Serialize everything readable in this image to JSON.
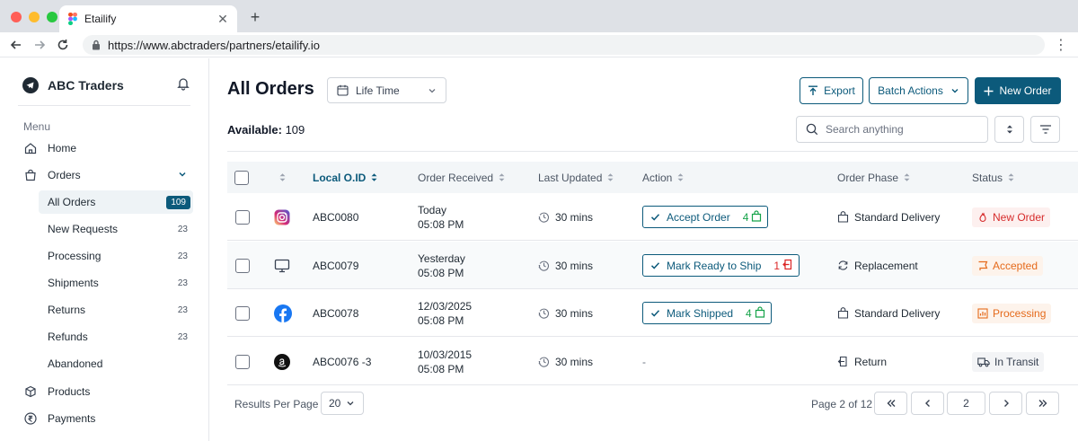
{
  "browser": {
    "tab_title": "Etailify",
    "url": "https://www.abctraders/partners/etailify.io"
  },
  "sidebar": {
    "brand": "ABC Traders",
    "menu_label": "Menu",
    "items": {
      "home": "Home",
      "orders": "Orders",
      "products": "Products",
      "payments": "Payments"
    },
    "sub_items": [
      {
        "label": "All Orders",
        "count": "109"
      },
      {
        "label": "New Requests",
        "count": "23"
      },
      {
        "label": "Processing",
        "count": "23"
      },
      {
        "label": "Shipments",
        "count": "23"
      },
      {
        "label": "Returns",
        "count": "23"
      },
      {
        "label": "Refunds",
        "count": "23"
      },
      {
        "label": "Abandoned",
        "count": ""
      }
    ]
  },
  "header": {
    "title": "All Orders",
    "date_filter": "Life Time",
    "export_label": "Export",
    "batch_label": "Batch Actions",
    "new_order_label": "New Order",
    "available_label": "Available:",
    "available_value": "109",
    "search_placeholder": "Search anything"
  },
  "table": {
    "columns": {
      "local_oid": "Local O.ID",
      "order_received": "Order Received",
      "last_updated": "Last Updated",
      "action": "Action",
      "order_phase": "Order Phase",
      "status": "Status"
    },
    "rows": [
      {
        "channel_icon": "instagram-icon",
        "oid": "ABC0080",
        "received_date": "Today",
        "received_time": "05:08 PM",
        "updated": "30 mins",
        "action": "Accept Order",
        "action_count": "4",
        "phase": "Standard Delivery",
        "status": "New Order",
        "status_color": "#d62c2c",
        "status_bg": "#fdf0ef"
      },
      {
        "channel_icon": "desktop-icon",
        "oid": "ABC0079",
        "received_date": "Yesterday",
        "received_time": "05:08 PM",
        "updated": "30 mins",
        "action": "Mark Ready to Ship",
        "action_count": "1",
        "phase": "Replacement",
        "status": "Accepted",
        "status_color": "#e56a1b",
        "status_bg": "#fdf3eb"
      },
      {
        "channel_icon": "facebook-icon",
        "oid": "ABC0078",
        "received_date": "12/03/2025",
        "received_time": "05:08 PM",
        "updated": "30 mins",
        "action": "Mark Shipped",
        "action_count": "4",
        "phase": "Standard Delivery",
        "status": "Processing",
        "status_color": "#e56a1b",
        "status_bg": "#fdf3eb"
      },
      {
        "channel_icon": "amazon-icon",
        "oid": "ABC0076 -3",
        "received_date": "10/03/2015",
        "received_time": "05:08 PM",
        "updated": "30 mins",
        "action": "-",
        "action_count": "",
        "phase": "Return",
        "status": "In Transit",
        "status_color": "#374151",
        "status_bg": "#f3f4f6"
      }
    ]
  },
  "footer": {
    "results_label": "Results Per Page",
    "per_page": "20",
    "page_info": "Page 2 of 12",
    "current_page": "2"
  },
  "colors": {
    "brand": "#0c5a7b",
    "success": "#16a34a",
    "danger": "#dc2626"
  }
}
